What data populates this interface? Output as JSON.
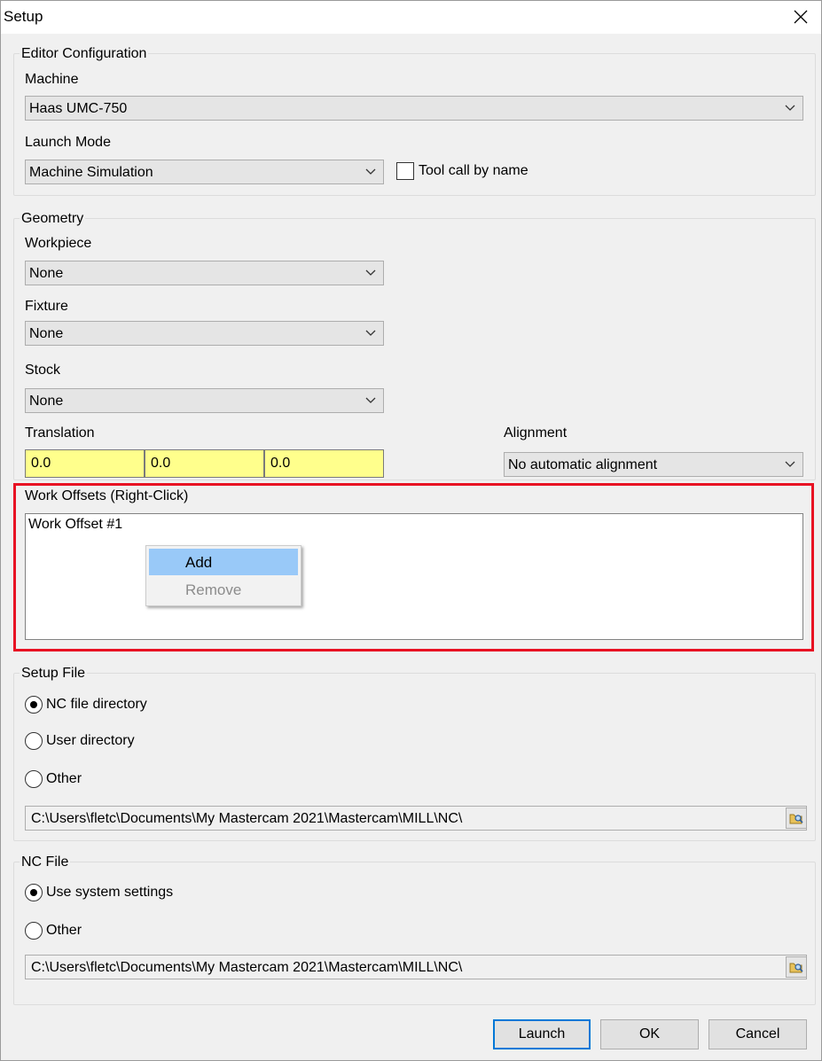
{
  "window": {
    "title": "Setup"
  },
  "editor_config": {
    "legend": "Editor Configuration",
    "machine_label": "Machine",
    "machine_value": "Haas UMC-750",
    "launch_mode_label": "Launch Mode",
    "launch_mode_value": "Machine Simulation",
    "tool_call_label": "Tool call by name",
    "tool_call_checked": false
  },
  "geometry": {
    "legend": "Geometry",
    "workpiece_label": "Workpiece",
    "workpiece_value": "None",
    "fixture_label": "Fixture",
    "fixture_value": "None",
    "stock_label": "Stock",
    "stock_value": "None",
    "translation_label": "Translation",
    "translation": [
      "0.0",
      "0.0",
      "0.0"
    ],
    "alignment_label": "Alignment",
    "alignment_value": "No automatic alignment"
  },
  "work_offsets": {
    "label": "Work Offsets (Right-Click)",
    "items": [
      "Work Offset #1"
    ],
    "context_menu": {
      "add": "Add",
      "remove": "Remove"
    },
    "highlight_color": "#e81123"
  },
  "setup_file": {
    "legend": "Setup File",
    "options": [
      "NC file directory",
      "User directory",
      "Other"
    ],
    "selected": "NC file directory",
    "path": "C:\\Users\\fletc\\Documents\\My Mastercam 2021\\Mastercam\\MILL\\NC\\"
  },
  "nc_file": {
    "legend": "NC File",
    "options": [
      "Use system settings",
      "Other"
    ],
    "selected": "Use system settings",
    "path": "C:\\Users\\fletc\\Documents\\My Mastercam 2021\\Mastercam\\MILL\\NC\\"
  },
  "buttons": {
    "launch": "Launch",
    "ok": "OK",
    "cancel": "Cancel"
  },
  "colors": {
    "menu_highlight": "#99c9f8",
    "translation_bg": "#ffff8c",
    "default_button_border": "#0078d7"
  }
}
